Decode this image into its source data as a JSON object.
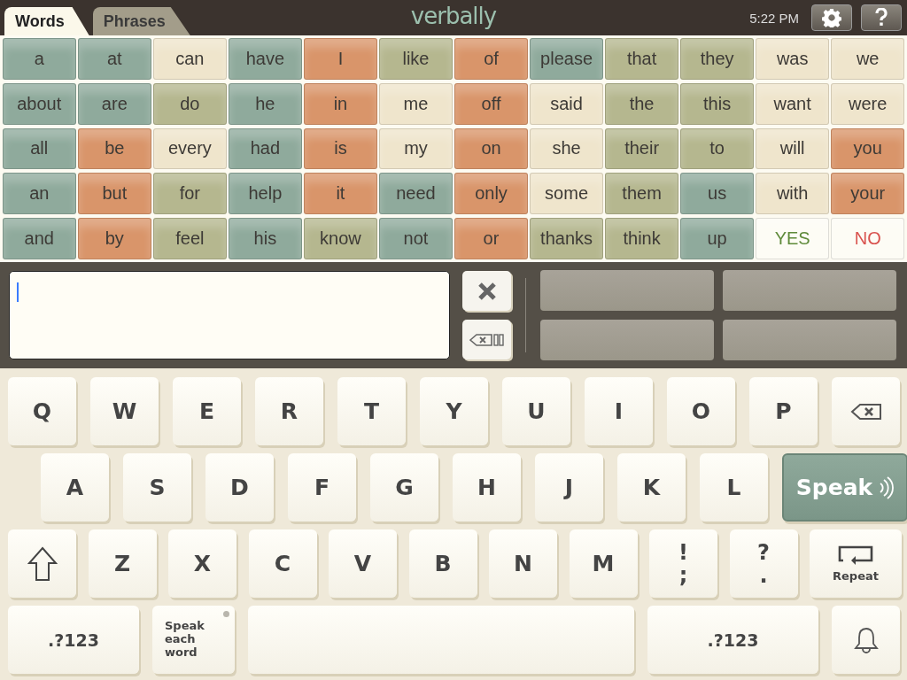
{
  "top_bar": {
    "tabs": [
      {
        "label": "Words",
        "selected": true
      },
      {
        "label": "Phrases",
        "selected": false
      }
    ],
    "logo": "verbally",
    "time": "5:22 PM"
  },
  "word_grid": [
    [
      {
        "label": "a",
        "color": "#8faa9c"
      },
      {
        "label": "at",
        "color": "#8faa9c"
      },
      {
        "label": "can",
        "color": "#efe5cc"
      },
      {
        "label": "have",
        "color": "#8faa9c"
      },
      {
        "label": "I",
        "color": "#d9956a"
      },
      {
        "label": "like",
        "color": "#b5b78f"
      },
      {
        "label": "of",
        "color": "#d9956a"
      },
      {
        "label": "please",
        "color": "#8faa9c"
      },
      {
        "label": "that",
        "color": "#b5b78f"
      },
      {
        "label": "they",
        "color": "#b5b78f"
      },
      {
        "label": "was",
        "color": "#efe5cc"
      },
      {
        "label": "we",
        "color": "#efe5cc"
      }
    ],
    [
      {
        "label": "about",
        "color": "#8faa9c"
      },
      {
        "label": "are",
        "color": "#8faa9c"
      },
      {
        "label": "do",
        "color": "#b5b78f"
      },
      {
        "label": "he",
        "color": "#8faa9c"
      },
      {
        "label": "in",
        "color": "#d9956a"
      },
      {
        "label": "me",
        "color": "#efe5cc"
      },
      {
        "label": "off",
        "color": "#d9956a"
      },
      {
        "label": "said",
        "color": "#efe5cc"
      },
      {
        "label": "the",
        "color": "#b5b78f"
      },
      {
        "label": "this",
        "color": "#b5b78f"
      },
      {
        "label": "want",
        "color": "#efe5cc"
      },
      {
        "label": "were",
        "color": "#efe5cc"
      }
    ],
    [
      {
        "label": "all",
        "color": "#8faa9c"
      },
      {
        "label": "be",
        "color": "#d9956a"
      },
      {
        "label": "every",
        "color": "#efe5cc"
      },
      {
        "label": "had",
        "color": "#8faa9c"
      },
      {
        "label": "is",
        "color": "#d9956a"
      },
      {
        "label": "my",
        "color": "#efe5cc"
      },
      {
        "label": "on",
        "color": "#d9956a"
      },
      {
        "label": "she",
        "color": "#efe5cc"
      },
      {
        "label": "their",
        "color": "#b5b78f"
      },
      {
        "label": "to",
        "color": "#b5b78f"
      },
      {
        "label": "will",
        "color": "#efe5cc"
      },
      {
        "label": "you",
        "color": "#d9956a"
      }
    ],
    [
      {
        "label": "an",
        "color": "#8faa9c"
      },
      {
        "label": "but",
        "color": "#d9956a"
      },
      {
        "label": "for",
        "color": "#b5b78f"
      },
      {
        "label": "help",
        "color": "#8faa9c"
      },
      {
        "label": "it",
        "color": "#d9956a"
      },
      {
        "label": "need",
        "color": "#8faa9c"
      },
      {
        "label": "only",
        "color": "#d9956a"
      },
      {
        "label": "some",
        "color": "#efe5cc"
      },
      {
        "label": "them",
        "color": "#b5b78f"
      },
      {
        "label": "us",
        "color": "#8faa9c"
      },
      {
        "label": "with",
        "color": "#efe5cc"
      },
      {
        "label": "your",
        "color": "#d9956a"
      }
    ],
    [
      {
        "label": "and",
        "color": "#8faa9c"
      },
      {
        "label": "by",
        "color": "#d9956a"
      },
      {
        "label": "feel",
        "color": "#b5b78f"
      },
      {
        "label": "his",
        "color": "#8faa9c"
      },
      {
        "label": "know",
        "color": "#b5b78f"
      },
      {
        "label": "not",
        "color": "#8faa9c"
      },
      {
        "label": "or",
        "color": "#d9956a"
      },
      {
        "label": "thanks",
        "color": "#b5b78f"
      },
      {
        "label": "think",
        "color": "#b5b78f"
      },
      {
        "label": "up",
        "color": "#8faa9c"
      },
      {
        "label": "YES",
        "color": "#fdfcf5",
        "kind": "yes"
      },
      {
        "label": "NO",
        "color": "#fdfcf5",
        "kind": "no"
      }
    ]
  ],
  "keyboard": [
    [
      {
        "kind": "letter",
        "label": "Q"
      },
      {
        "kind": "letter",
        "label": "W"
      },
      {
        "kind": "letter",
        "label": "E"
      },
      {
        "kind": "letter",
        "label": "R"
      },
      {
        "kind": "letter",
        "label": "T"
      },
      {
        "kind": "letter",
        "label": "Y"
      },
      {
        "kind": "letter",
        "label": "U"
      },
      {
        "kind": "letter",
        "label": "I"
      },
      {
        "kind": "letter",
        "label": "O"
      },
      {
        "kind": "letter",
        "label": "P"
      },
      {
        "kind": "backspace"
      }
    ],
    [
      {
        "kind": "letter",
        "label": "A"
      },
      {
        "kind": "letter",
        "label": "S"
      },
      {
        "kind": "letter",
        "label": "D"
      },
      {
        "kind": "letter",
        "label": "F"
      },
      {
        "kind": "letter",
        "label": "G"
      },
      {
        "kind": "letter",
        "label": "H"
      },
      {
        "kind": "letter",
        "label": "J"
      },
      {
        "kind": "letter",
        "label": "K"
      },
      {
        "kind": "letter",
        "label": "L"
      },
      {
        "kind": "speak",
        "label": "Speak"
      }
    ],
    [
      {
        "kind": "shift"
      },
      {
        "kind": "letter",
        "label": "Z"
      },
      {
        "kind": "letter",
        "label": "X"
      },
      {
        "kind": "letter",
        "label": "C"
      },
      {
        "kind": "letter",
        "label": "V"
      },
      {
        "kind": "letter",
        "label": "B"
      },
      {
        "kind": "letter",
        "label": "N"
      },
      {
        "kind": "letter",
        "label": "M"
      },
      {
        "kind": "dual",
        "label": "!",
        "sublabel": ";"
      },
      {
        "kind": "dual",
        "label": "?",
        "sublabel": "."
      },
      {
        "kind": "repeat",
        "label": "Repeat"
      }
    ],
    [
      {
        "kind": "small",
        "label": ".?123"
      },
      {
        "kind": "toggle",
        "label": "Speak each word",
        "on": false
      },
      {
        "kind": "space"
      },
      {
        "kind": "small",
        "label": ".?123"
      },
      {
        "kind": "bell"
      }
    ]
  ]
}
